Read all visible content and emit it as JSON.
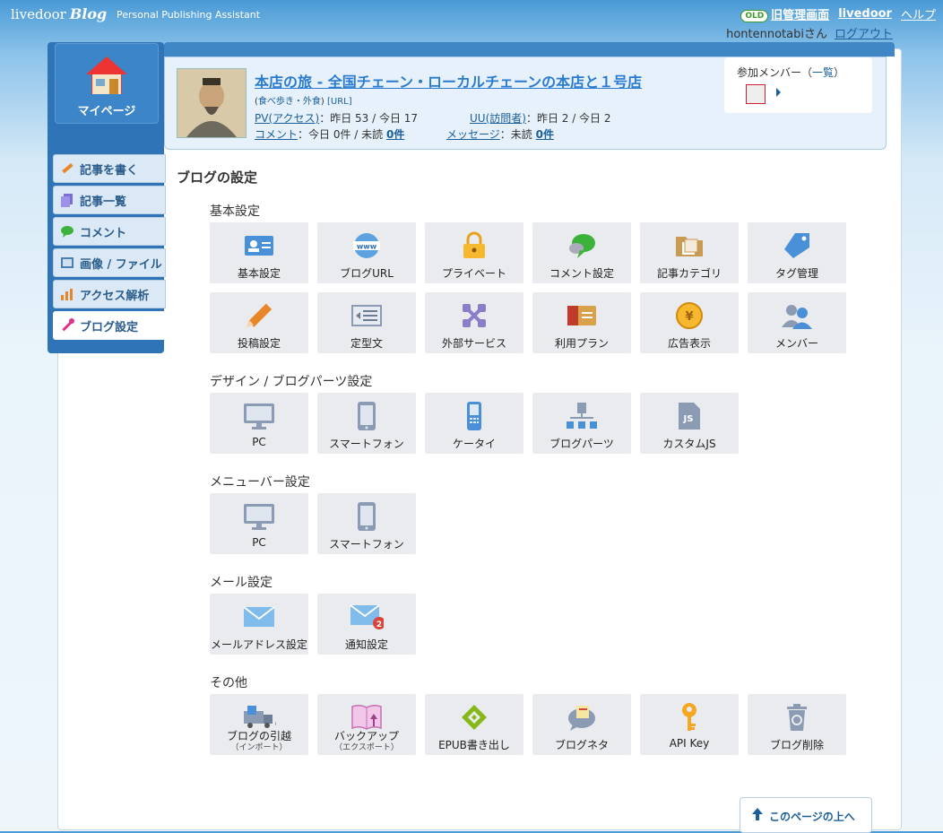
{
  "header": {
    "logo_text": "livedoor",
    "logo_blog": "Blog",
    "tagline": "Personal Publishing Assistant",
    "old_badge": "OLD",
    "old_admin_link": "旧管理画面",
    "livedoor_link": "livedoor",
    "help_link": "ヘルプ",
    "username": "hontennotabiさん",
    "logout_link": "ログアウト"
  },
  "sidebar": {
    "mypage_label": "マイページ",
    "items": [
      {
        "label": "記事を書く",
        "icon": "pencil-icon"
      },
      {
        "label": "記事一覧",
        "icon": "document-list-icon"
      },
      {
        "label": "コメント",
        "icon": "speech-bubble-icon"
      },
      {
        "label": "画像 / ファイル",
        "icon": "image-icon"
      },
      {
        "label": "アクセス解析",
        "icon": "bar-chart-icon"
      },
      {
        "label": "ブログ設定",
        "icon": "wrench-icon"
      }
    ]
  },
  "blog": {
    "title": "本店の旅 - 全国チェーン・ローカルチェーンの本店と１号店",
    "category": "食べ歩き・外食",
    "url_link": "[URL]",
    "pv_label": "PV(アクセス)",
    "pv_yesterday": "：昨日 53 / 今日 17",
    "uu_label": "UU(訪問者)",
    "uu_yesterday": "：昨日 2 / 今日 2",
    "comment_label": "コメント",
    "comment_today": "：今日 0件 / 未読",
    "comment_unread": "0件",
    "message_label": "メッセージ",
    "message_unread_prefix": "：未読",
    "message_unread": "0件"
  },
  "members": {
    "title": "参加メンバー（",
    "list_link": "一覧",
    "title_end": "）"
  },
  "page_title": "ブログの設定",
  "sections": {
    "basic": "基本設定",
    "design": "デザイン / ブログパーツ設定",
    "menubar": "メニューバー設定",
    "mail": "メール設定",
    "other": "その他"
  },
  "tiles": {
    "basic": [
      {
        "label": "基本設定",
        "icon": "id-card-icon"
      },
      {
        "label": "ブログURL",
        "icon": "www-globe-icon"
      },
      {
        "label": "プライベート",
        "icon": "lock-icon"
      },
      {
        "label": "コメント設定",
        "icon": "speech-bubble-icon"
      },
      {
        "label": "記事カテゴリ",
        "icon": "folder-icon"
      },
      {
        "label": "タグ管理",
        "icon": "tag-icon"
      },
      {
        "label": "投稿設定",
        "icon": "pencil-icon"
      },
      {
        "label": "定型文",
        "icon": "template-text-icon"
      },
      {
        "label": "外部サービス",
        "icon": "puzzle-icon"
      },
      {
        "label": "利用プラン",
        "icon": "plan-card-icon"
      },
      {
        "label": "広告表示",
        "icon": "yen-coin-icon"
      },
      {
        "label": "メンバー",
        "icon": "users-icon"
      }
    ],
    "design": [
      {
        "label": "PC",
        "icon": "monitor-icon"
      },
      {
        "label": "スマートフォン",
        "icon": "smartphone-icon"
      },
      {
        "label": "ケータイ",
        "icon": "feature-phone-icon"
      },
      {
        "label": "ブログパーツ",
        "icon": "blog-parts-icon"
      },
      {
        "label": "カスタムJS",
        "icon": "js-file-icon"
      }
    ],
    "menubar": [
      {
        "label": "PC",
        "icon": "monitor-icon"
      },
      {
        "label": "スマートフォン",
        "icon": "smartphone-icon"
      }
    ],
    "mail": [
      {
        "label": "メールアドレス設定",
        "icon": "envelope-icon"
      },
      {
        "label": "通知設定",
        "icon": "envelope-notification-icon",
        "badge": "2"
      }
    ],
    "other": [
      {
        "label": "ブログの引越",
        "sub": "（インポート）",
        "icon": "moving-truck-icon"
      },
      {
        "label": "バックアップ",
        "sub": "（エクスポート）",
        "icon": "book-export-icon"
      },
      {
        "label": "EPUB書き出し",
        "icon": "epub-icon"
      },
      {
        "label": "ブログネタ",
        "icon": "blog-neta-icon"
      },
      {
        "label": "API Key",
        "icon": "key-icon"
      },
      {
        "label": "ブログ削除",
        "icon": "trash-icon"
      }
    ]
  },
  "totop_label": "このページの上へ",
  "colors": {
    "accent": "#2f74b6",
    "link": "#1a5f99",
    "title_link": "#2a7bd0",
    "tile_bg": "#e9ebee"
  }
}
